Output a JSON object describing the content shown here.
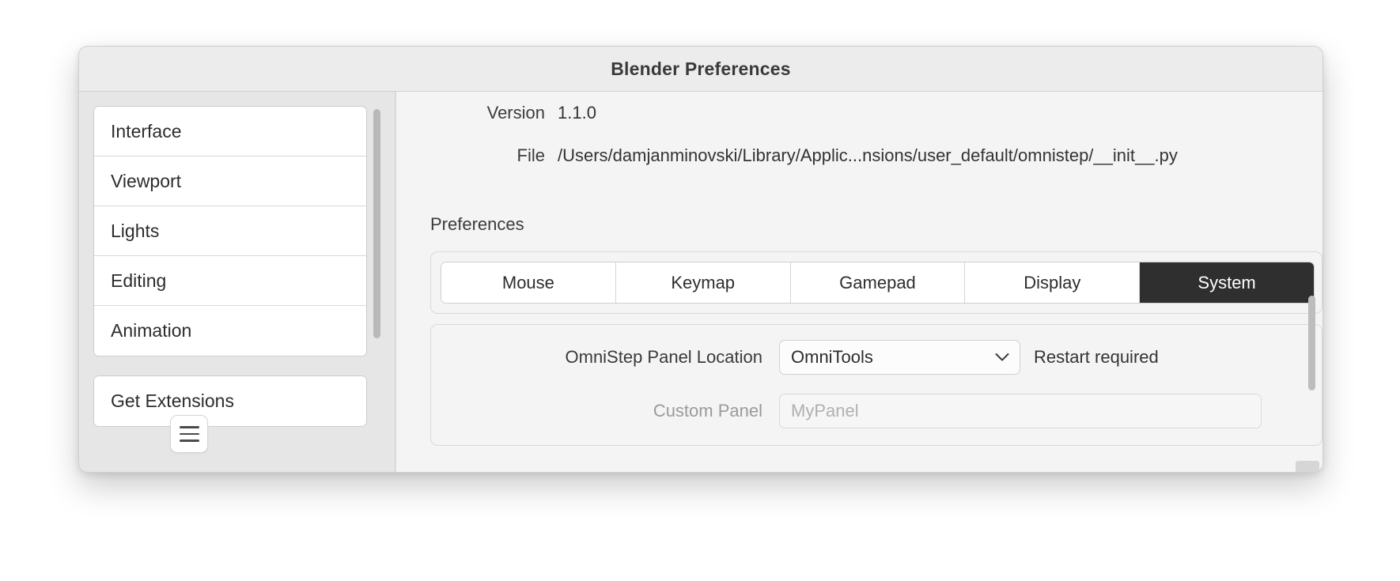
{
  "window": {
    "title": "Blender Preferences"
  },
  "sidebar": {
    "groups": [
      {
        "items": [
          {
            "label": "Interface"
          },
          {
            "label": "Viewport"
          },
          {
            "label": "Lights"
          },
          {
            "label": "Editing"
          },
          {
            "label": "Animation"
          }
        ]
      },
      {
        "items": [
          {
            "label": "Get Extensions"
          }
        ]
      }
    ],
    "menu_button_icon": "hamburger-menu-icon"
  },
  "content": {
    "properties": [
      {
        "label": "Version",
        "value": "1.1.0"
      },
      {
        "label": "File",
        "value": "/Users/damjanminovski/Library/Applic...nsions/user_default/omnistep/__init__.py"
      }
    ],
    "section_title": "Preferences",
    "tabs": [
      {
        "label": "Mouse",
        "active": false
      },
      {
        "label": "Keymap",
        "active": false
      },
      {
        "label": "Gamepad",
        "active": false
      },
      {
        "label": "Display",
        "active": false
      },
      {
        "label": "System",
        "active": true
      }
    ],
    "settings": {
      "panel_location": {
        "label": "OmniStep Panel Location",
        "value": "OmniTools",
        "chevron_icon": "chevron-down-icon",
        "hint": "Restart required"
      },
      "custom_panel": {
        "label": "Custom Panel",
        "value": "",
        "placeholder": "MyPanel"
      }
    }
  },
  "colors": {
    "accent_selected": "#2f2f2f",
    "window_bg": "#f5f5f5",
    "titlebar_bg": "#ececec",
    "sidebar_bg": "#e6e6e6",
    "content_bg": "#f4f4f4"
  }
}
